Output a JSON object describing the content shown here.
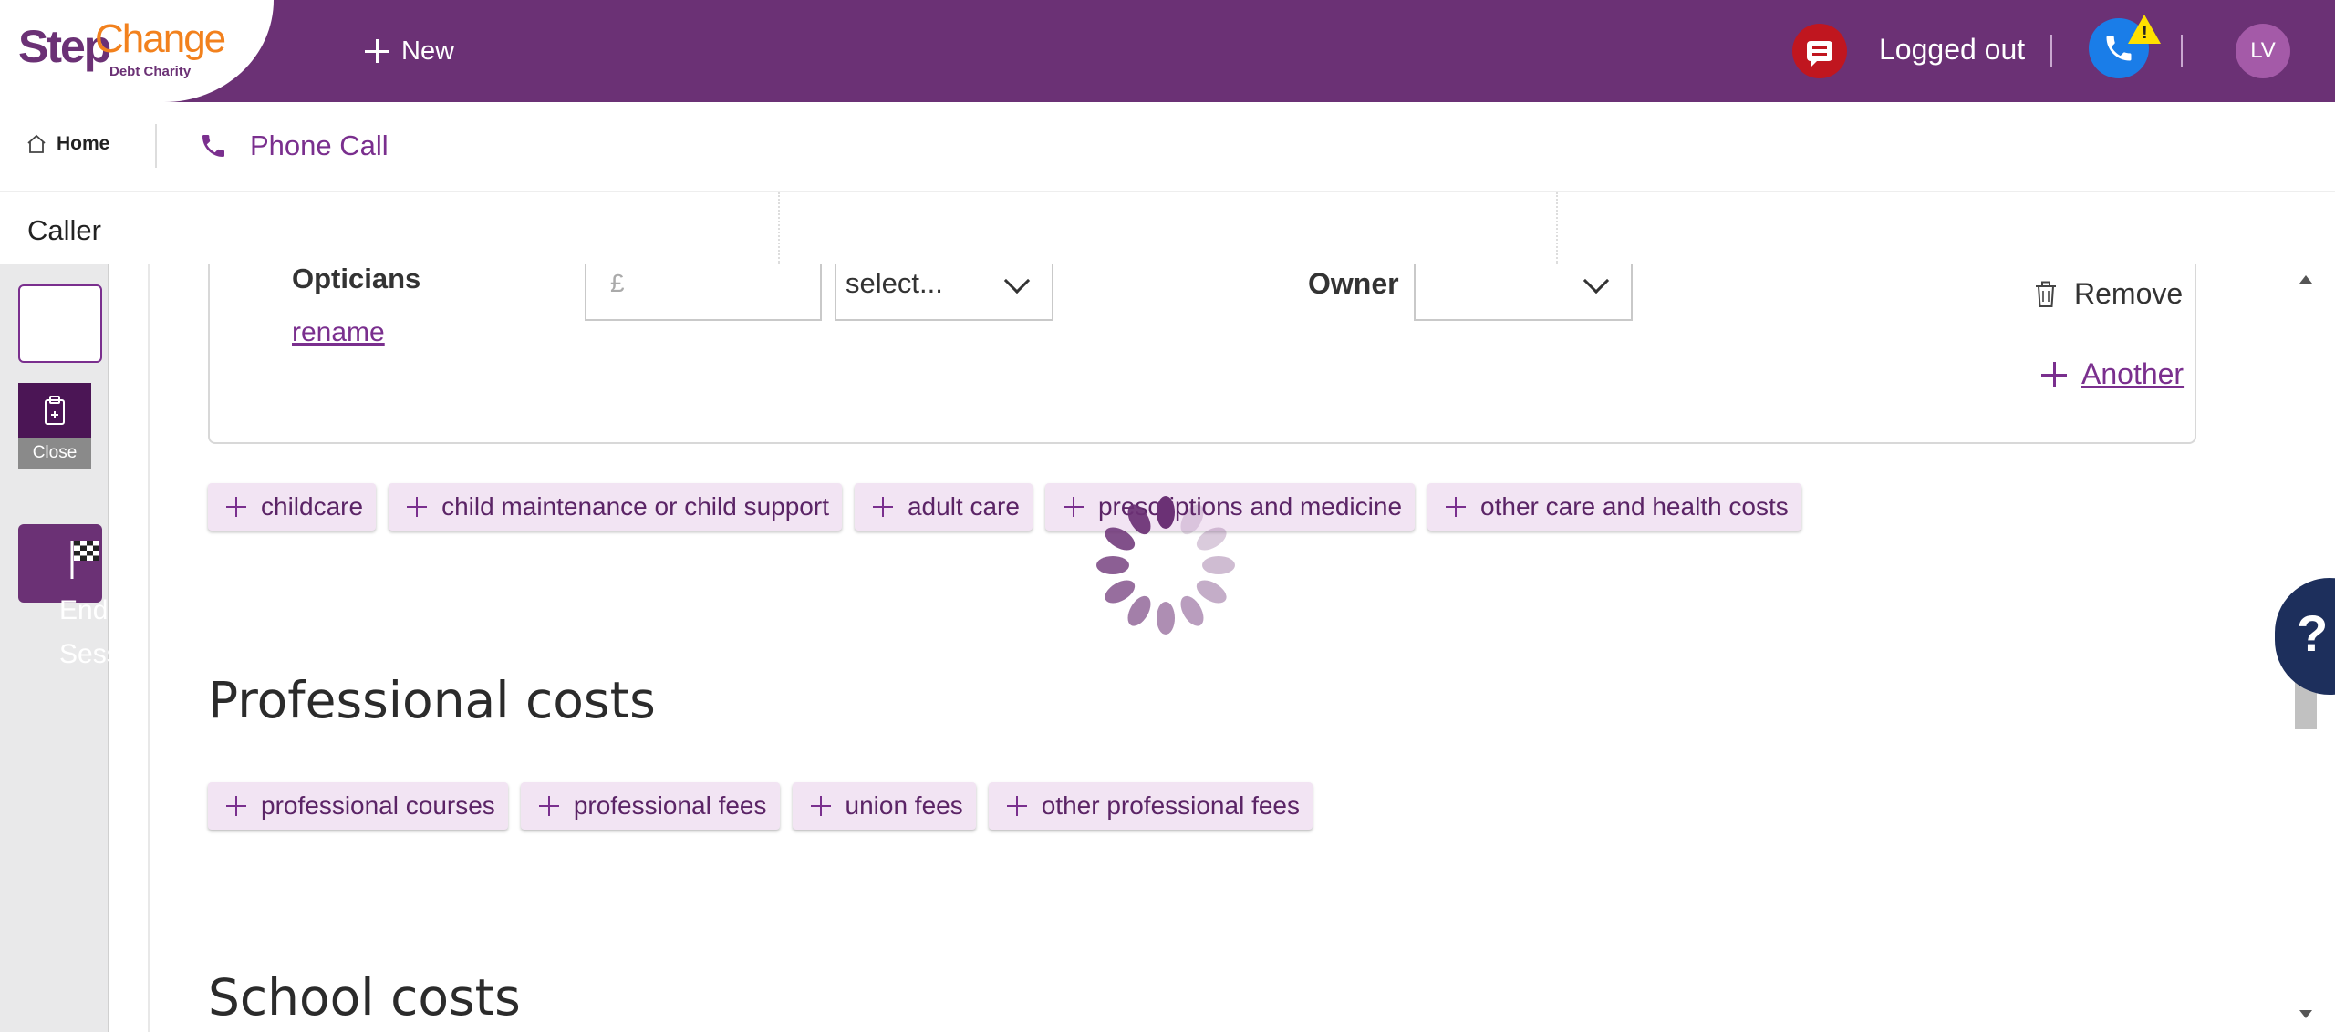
{
  "header": {
    "logo_step": "Step",
    "logo_change": "Change",
    "logo_sub": "Debt Charity",
    "new_label": "New",
    "status_label": "Logged out",
    "avatar_initials": "LV",
    "warning_glyph": "!"
  },
  "tabs": {
    "home_label": "Home",
    "call_label": "Phone Call"
  },
  "caller": {
    "label": "Caller"
  },
  "rail": {
    "close_label": "Close",
    "end_label": "End Session"
  },
  "expense_row": {
    "name": "Opticians",
    "rename_label": "rename",
    "amount_placeholder": "£",
    "frequency_value": "select...",
    "owner_label": "Owner",
    "owner_value": "",
    "remove_label": "Remove",
    "another_label": "Another"
  },
  "care_chips": [
    {
      "label": "childcare"
    },
    {
      "label": "child maintenance or child support"
    },
    {
      "label": "adult care"
    },
    {
      "label": "prescriptions and medicine"
    },
    {
      "label": "other care and health costs"
    }
  ],
  "professional": {
    "heading": "Professional costs",
    "chips": [
      {
        "label": "professional courses"
      },
      {
        "label": "professional fees"
      },
      {
        "label": "union fees"
      },
      {
        "label": "other professional fees"
      }
    ]
  },
  "school": {
    "heading": "School costs"
  },
  "help": {
    "label": "?"
  },
  "colors": {
    "brand_purple": "#6b3175",
    "brand_orange": "#f2811d",
    "chip_bg": "#f2e4f3",
    "link_purple": "#7a2f8e",
    "help_navy": "#1d2f5c",
    "chat_red": "#c0161f",
    "phone_blue": "#1a7de8"
  },
  "icons": [
    "plus-icon",
    "chat-icon",
    "phone-icon",
    "warning-icon",
    "home-icon",
    "clipboard-icon",
    "flag-icon",
    "trash-icon",
    "chevron-down-icon",
    "loading-spinner-icon",
    "help-icon"
  ]
}
